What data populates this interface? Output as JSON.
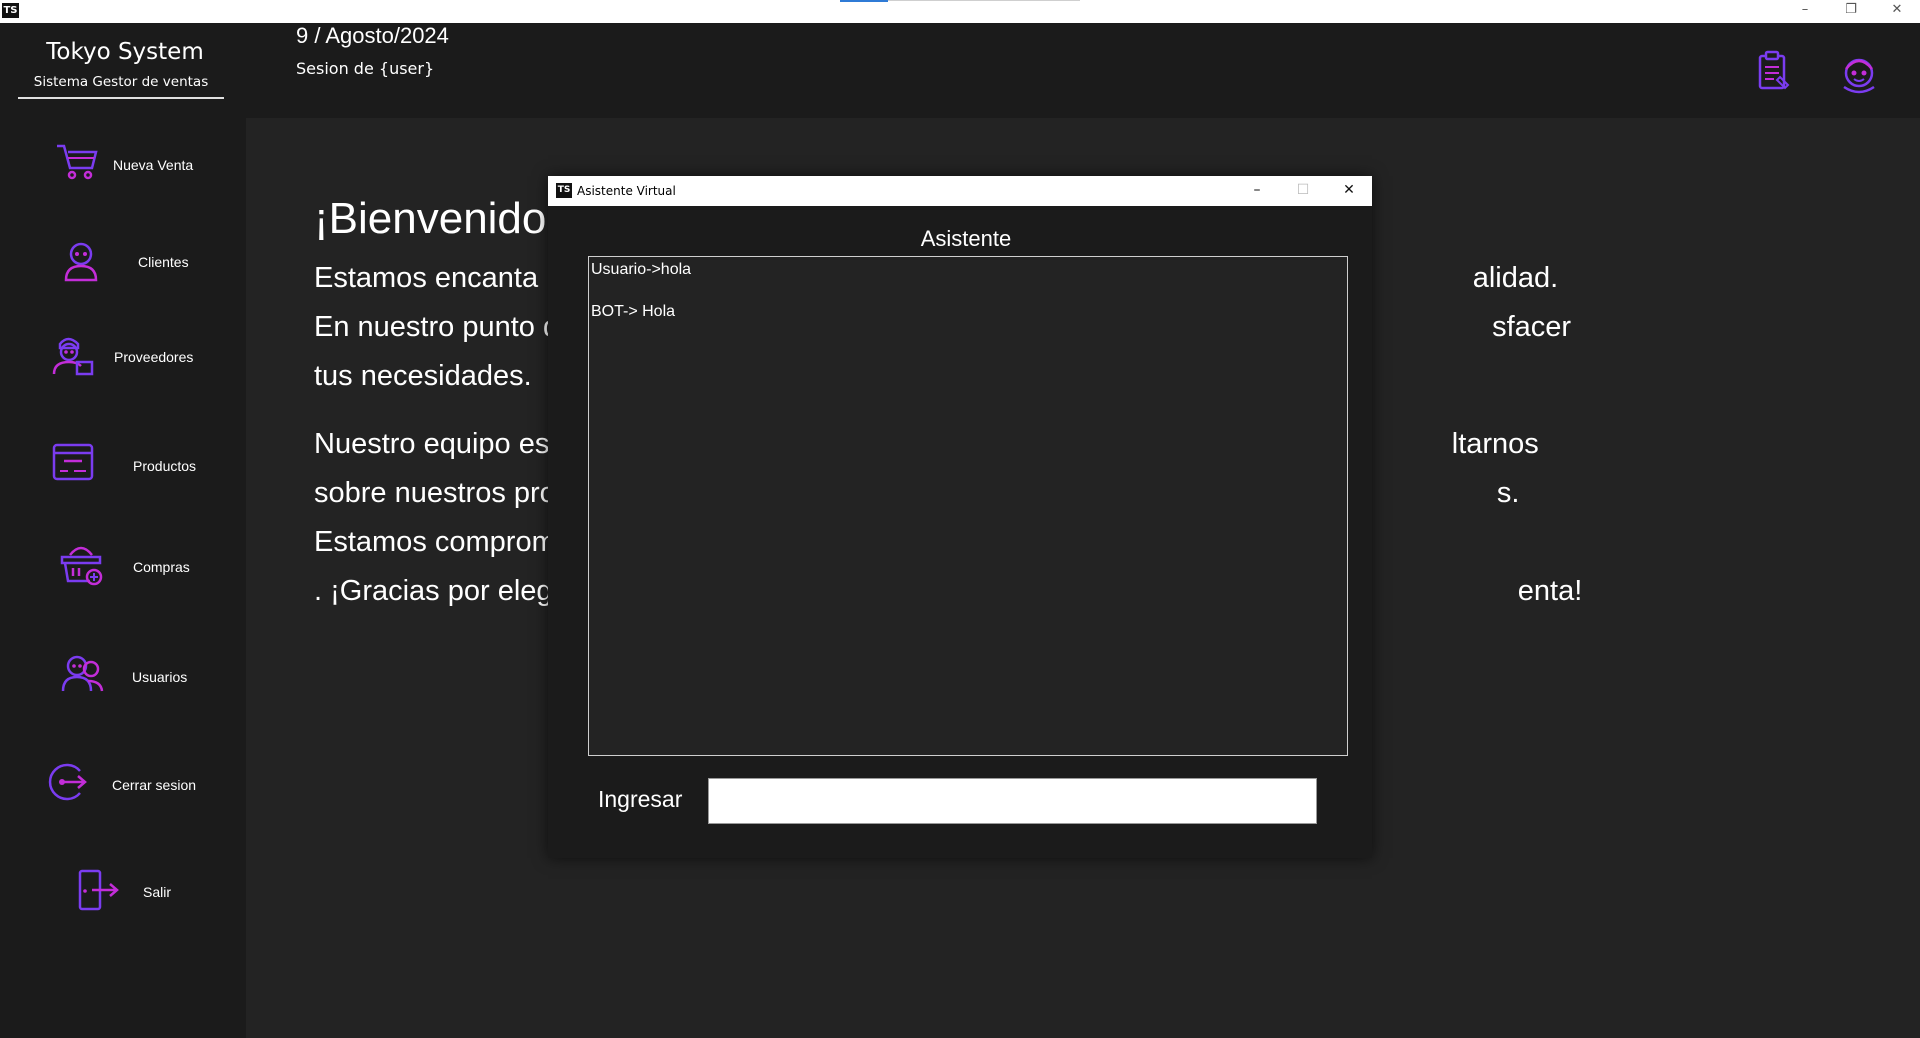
{
  "os": {
    "logo": "TS",
    "minimize": "–",
    "restore": "❐",
    "close": "✕"
  },
  "brand": {
    "title": "Tokyo System",
    "subtitle": "Sistema Gestor de ventas"
  },
  "header": {
    "date": "9 / Agosto/2024",
    "session": "Sesion de {user}",
    "icons": [
      "clipboard-icon",
      "user-avatar-icon"
    ]
  },
  "accent_color": "#7b3cf0",
  "accent_color2": "#c32dd8",
  "sidebar": {
    "items": [
      {
        "label": "Nueva Venta",
        "icon": "shopping-cart-icon"
      },
      {
        "label": "Clientes",
        "icon": "client-icon"
      },
      {
        "label": "Proveedores",
        "icon": "supplier-icon"
      },
      {
        "label": "Productos",
        "icon": "product-box-icon"
      },
      {
        "label": "Compras",
        "icon": "basket-icon"
      },
      {
        "label": "Usuarios",
        "icon": "users-icon"
      },
      {
        "label": "Cerrar sesion",
        "icon": "logout-icon"
      },
      {
        "label": "Salir",
        "icon": "exit-door-icon"
      }
    ]
  },
  "main": {
    "welcome_title": "¡Bienvenido",
    "paragraph1": "Estamos encanta                                                                                                                    alidad. En nuestro punto de v                                                                                                               sfacer tus necesidades.",
    "paragraph2": "Nuestro equipo es                                                                                                                ltarnos sobre nuestros producto                                                                                                            s. Estamos comprometidos er                                                                                                                 . ¡Gracias por elegi                                                                                                                       enta!"
  },
  "dialog": {
    "logo": "TS",
    "title": "Asistente Virtual",
    "minimize": "–",
    "maximize": "☐",
    "close": "✕",
    "heading": "Asistente",
    "messages": [
      "Usuario->hola",
      "BOT-> Hola"
    ],
    "input_label": "Ingresar",
    "input_value": ""
  }
}
